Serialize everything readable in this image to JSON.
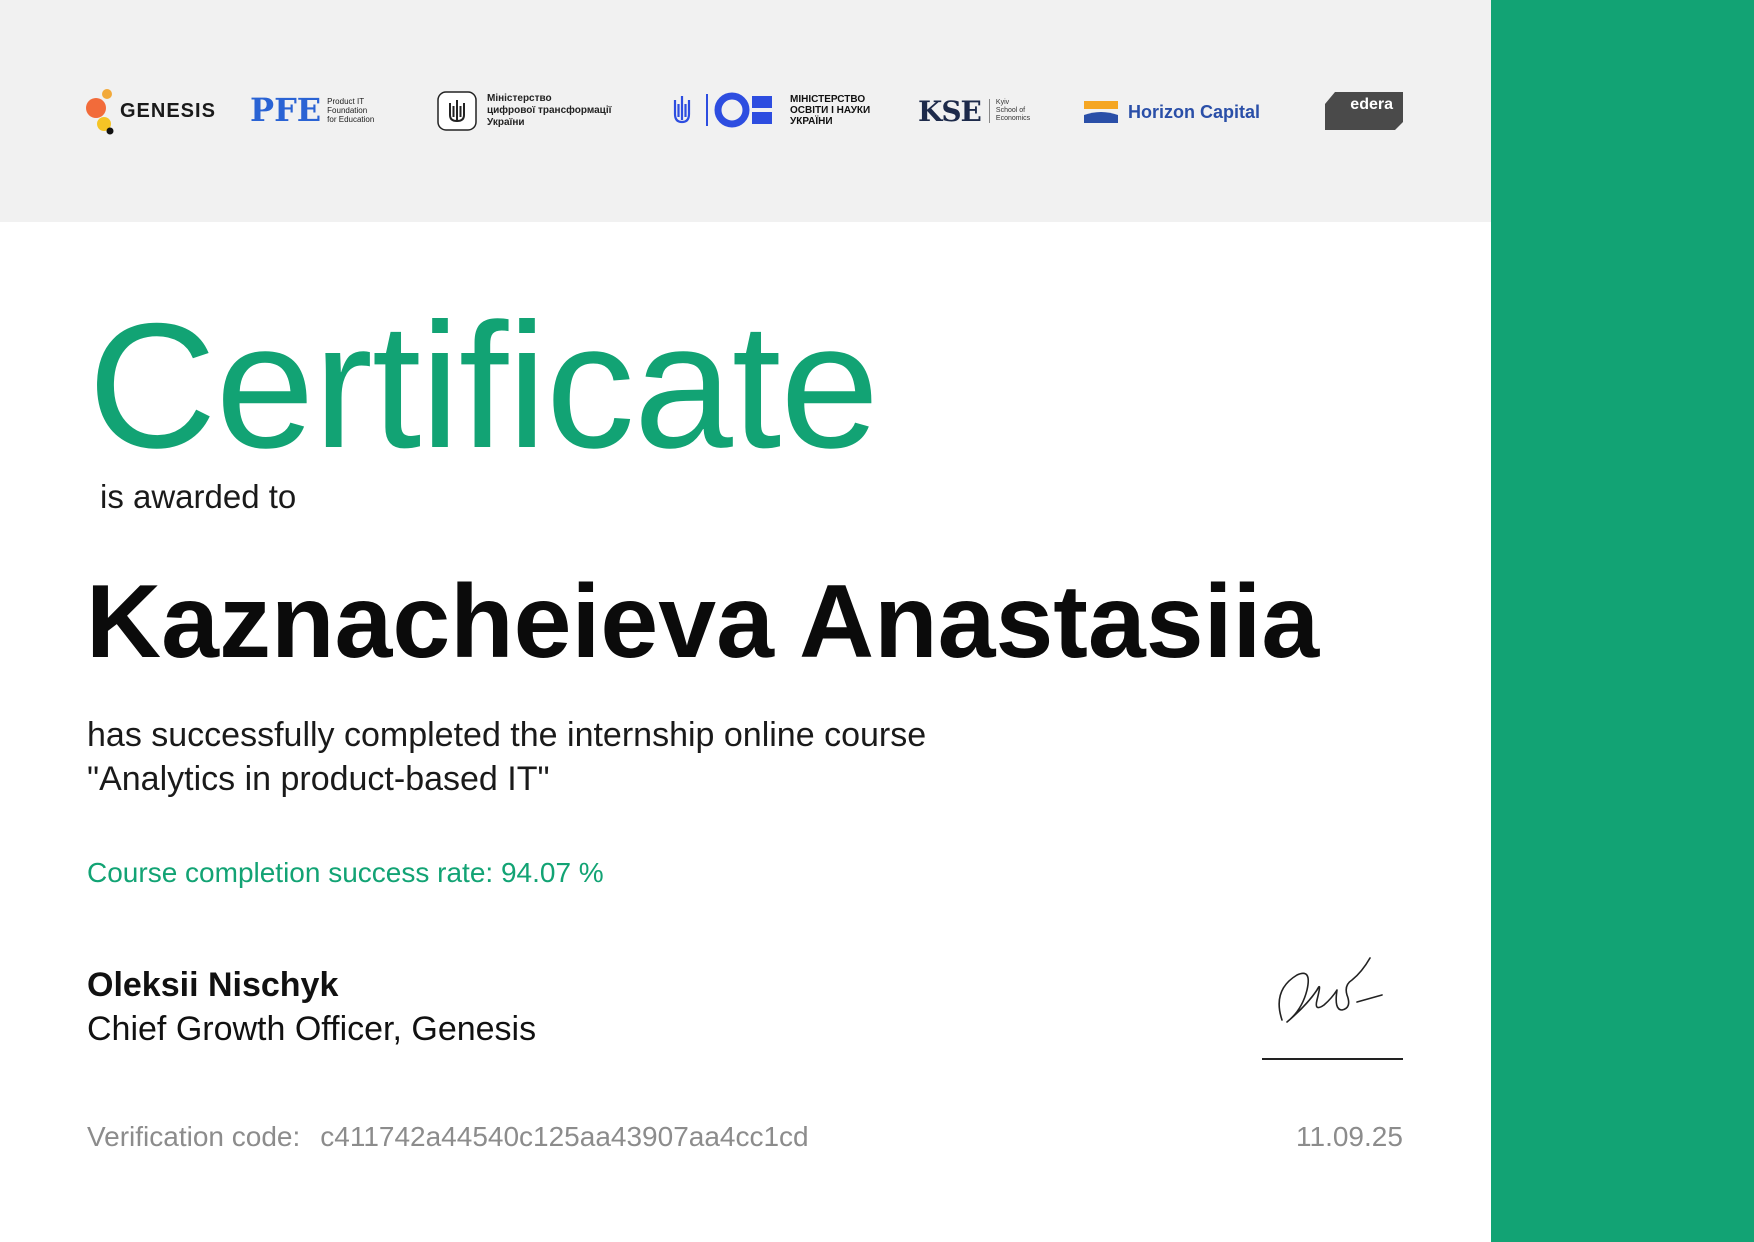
{
  "logos": {
    "genesis": "GENESIS",
    "pfe_mark": "PFE",
    "pfe_lines": [
      "Product IT",
      "Foundation",
      "for Education"
    ],
    "mdt_lines": [
      "Міністерство",
      "цифрової трансформації",
      "України"
    ],
    "mon_lines": [
      "МІНІСТЕРСТВО",
      "ОСВІТИ І НАУКИ",
      "УКРАЇНИ"
    ],
    "kse_mark": "KSE",
    "kse_lines": [
      "Kyiv",
      "School of",
      "Economics"
    ],
    "horizon": "Horizon Capital",
    "edera": "edera"
  },
  "certificate": {
    "title": "Certificate",
    "awarded_to": "is awarded to",
    "recipient": "Kaznacheieva Anastasiia",
    "completion_line1": "has successfully completed the internship online course",
    "completion_line2": "\"Analytics in product-based IT\"",
    "success_rate": "Course completion success rate: 94.07 %",
    "signer_name": "Oleksii Nischyk",
    "signer_role": "Chief Growth Officer, Genesis",
    "verification_label": "Verification code:",
    "verification_code": "c411742a44540c125aa43907aa4cc1cd",
    "date": "11.09.25"
  },
  "colors": {
    "accent": "#12a374",
    "band": "#f1f1f1",
    "muted": "#8c8c8c"
  }
}
